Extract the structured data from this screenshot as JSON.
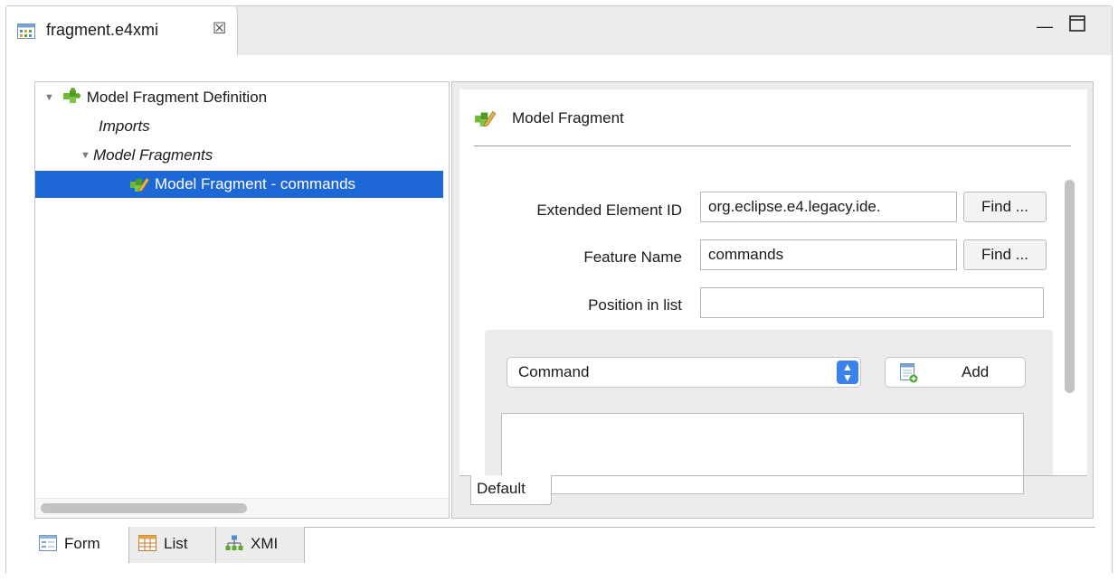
{
  "editor_tab": {
    "title": "fragment.e4xmi"
  },
  "tree": {
    "root": "Model Fragment Definition",
    "imports": "Imports",
    "model_fragments": "Model Fragments",
    "selected_item": "Model Fragment - commands"
  },
  "details": {
    "header": "Model Fragment",
    "extended_element_id": {
      "label": "Extended Element ID",
      "value": "org.eclipse.e4.legacy.ide.",
      "find": "Find ..."
    },
    "feature_name": {
      "label": "Feature Name",
      "value": "commands",
      "find": "Find ..."
    },
    "position_in_list": {
      "label": "Position in list",
      "value": ""
    },
    "element_type": {
      "selected": "Command"
    },
    "add_button": "Add",
    "bottom_tab": "Default"
  },
  "page_tabs": [
    {
      "label": "Form",
      "icon": "form-icon"
    },
    {
      "label": "List",
      "icon": "table-icon"
    },
    {
      "label": "XMI",
      "icon": "hierarchy-icon"
    }
  ],
  "colors": {
    "selection": "#1d67d6",
    "combo_accent": "#3b82f0",
    "fragment_green": "#5fa82e"
  }
}
